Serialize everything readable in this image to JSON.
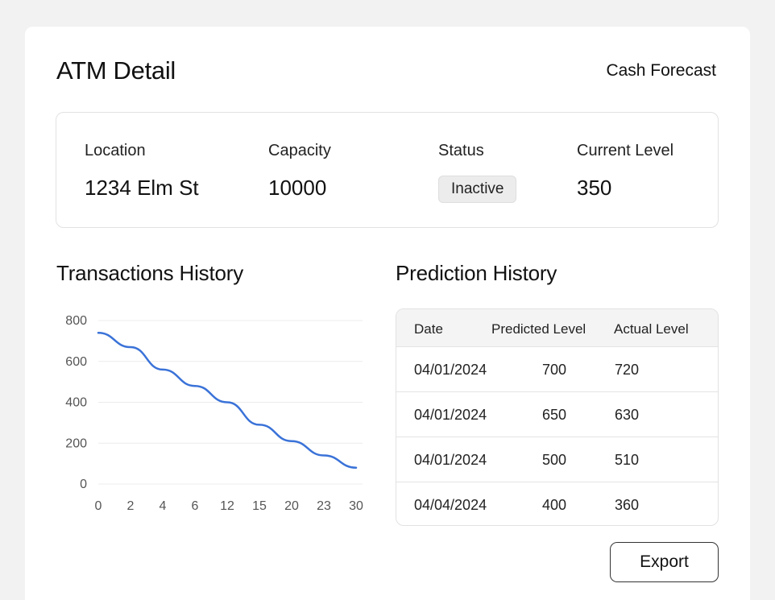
{
  "header": {
    "title": "ATM Detail",
    "cash_forecast_label": "Cash Forecast"
  },
  "info": {
    "location_label": "Location",
    "location_value": "1234 Elm St",
    "capacity_label": "Capacity",
    "capacity_value": "10000",
    "status_label": "Status",
    "status_value": "Inactive",
    "current_level_label": "Current Level",
    "current_level_value": "350"
  },
  "transactions": {
    "title": "Transactions History"
  },
  "chart_data": {
    "type": "line",
    "title": "Transactions History",
    "x_ticks": [
      "0",
      "2",
      "4",
      "6",
      "12",
      "15",
      "20",
      "23",
      "30"
    ],
    "y_ticks": [
      "800",
      "600",
      "400",
      "200",
      "0"
    ],
    "ylim": [
      0,
      800
    ],
    "grid": true,
    "series": [
      {
        "values": [
          740,
          670,
          560,
          480,
          400,
          290,
          210,
          140,
          80
        ],
        "color": "#3a72d8"
      }
    ]
  },
  "predictions": {
    "title": "Prediction History",
    "columns": [
      "Date",
      "Predicted Level",
      "Actual Level"
    ],
    "rows": [
      {
        "date": "04/01/2024",
        "predicted": "700",
        "actual": "720"
      },
      {
        "date": "04/01/2024",
        "predicted": "650",
        "actual": "630"
      },
      {
        "date": "04/01/2024",
        "predicted": "500",
        "actual": "510"
      },
      {
        "date": "04/04/2024",
        "predicted": "400",
        "actual": "360"
      }
    ]
  },
  "actions": {
    "export_label": "Export"
  }
}
